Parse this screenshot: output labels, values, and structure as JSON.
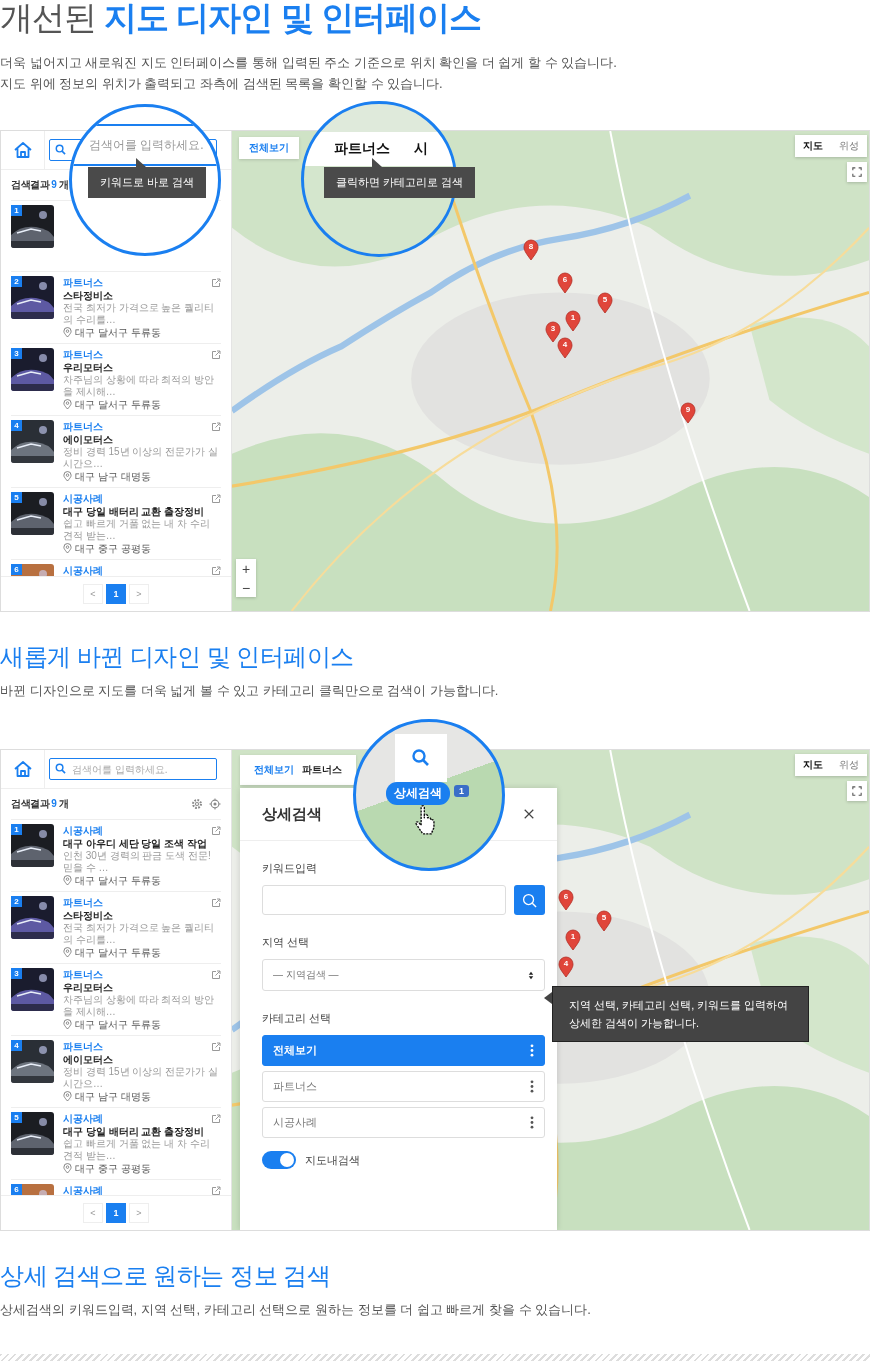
{
  "sections": [
    {
      "kind": "hero",
      "title": "개선된 **지도 디자인 및 인터페이스**",
      "description": [
        "더욱 넓어지고 새로워진 지도 인터페이스를 통해 입력된 주소 기준으로 위치 확인을 더 쉽게 할 수 있습니다.",
        "지도 위에 정보의 위치가 출력되고 좌측에 검색된 목록을 확인할 수 있습니다."
      ],
      "demo": {
        "sidebar": {
          "result_label": "검색결과",
          "result_count": "9",
          "result_unit": "개",
          "items": [
            {
              "kind": "covered",
              "number": "1"
            },
            {
              "kind": "full",
              "number": "2",
              "category": "파트너스",
              "title": "스타정비소",
              "description": "전국 최저가 가격으로 높은 퀄리티의 수리를…",
              "location": "대구 달서구 두류동"
            },
            {
              "kind": "full",
              "number": "3",
              "category": "파트너스",
              "title": "우리모터스",
              "description": "차주님의 상황에 따라 최적의 방안을 제시해…",
              "location": "대구 달서구 두류동"
            },
            {
              "kind": "full",
              "number": "4",
              "category": "파트너스",
              "title": "에이모터스",
              "description": "정비 경력 15년 이상의 전문가가 실시간으…",
              "location": "대구 남구 대명동"
            },
            {
              "kind": "full",
              "number": "5",
              "category": "시공사례",
              "title": "대구 당일 배터리 교환 출장정비",
              "description": "쉽고 빠르게 거품 없는 내 차 수리 견적 받는…",
              "location": "대구 중구 공평동"
            },
            {
              "kind": "partial",
              "number": "6",
              "category": "시공사례"
            }
          ],
          "pagination": {
            "prev": "<",
            "pages": [
              {
                "label": "1",
                "selected": true
              }
            ],
            "next": ">"
          }
        },
        "tabs": [
          {
            "label": "전체보기",
            "selected": true
          }
        ],
        "map": {
          "map_types": [
            {
              "label": "지도",
              "selected": true
            },
            {
              "label": "위성",
              "selected": false
            }
          ],
          "zoom": {
            "plus": "+",
            "minus": "−"
          },
          "markers": [
            {
              "label": "8"
            },
            {
              "label": "6"
            },
            {
              "label": "5"
            },
            {
              "label": "1"
            },
            {
              "label": "3"
            },
            {
              "label": "4"
            },
            {
              "label": "9"
            }
          ]
        },
        "magnifiers": [
          {
            "kind": "search",
            "placeholder": "검색어를 입력하세요.",
            "tooltip": "키워드로 바로 검색"
          },
          {
            "kind": "tabs",
            "tabs": [
              "파트너스",
              "시"
            ],
            "tooltip": "클릭하면 카테고리로 검색"
          }
        ]
      }
    },
    {
      "kind": "sub",
      "title": "새롭게 바뀐 디자인 및 인터페이스",
      "description": [
        "바뀐 디자인으로 지도를 더욱 넓게 볼 수 있고 카테고리 클릭만으로 검색이 가능합니다."
      ],
      "demo": {
        "sidebar": {
          "search_placeholder": "검색어를 입력하세요.",
          "result_label": "검색결과",
          "result_count": "9",
          "result_unit": "개",
          "tool_icons": true,
          "items": [
            {
              "kind": "full",
              "number": "1",
              "category": "시공사례",
              "title": "대구 아우디 세단 당일 조색 작업",
              "description": "인천 30년 경력의 판금 도색 전문! 믿을 수 …",
              "location": "대구 달서구 두류동"
            },
            {
              "kind": "full",
              "number": "2",
              "category": "파트너스",
              "title": "스타정비소",
              "description": "전국 최저가 가격으로 높은 퀄리티의 수리를…",
              "location": "대구 달서구 두류동"
            },
            {
              "kind": "full",
              "number": "3",
              "category": "파트너스",
              "title": "우리모터스",
              "description": "차주님의 상황에 따라 최적의 방안을 제시해…",
              "location": "대구 달서구 두류동"
            },
            {
              "kind": "full",
              "number": "4",
              "category": "파트너스",
              "title": "에이모터스",
              "description": "정비 경력 15년 이상의 전문가가 실시간으…",
              "location": "대구 남구 대명동"
            },
            {
              "kind": "full",
              "number": "5",
              "category": "시공사례",
              "title": "대구 당일 배터리 교환 출장정비",
              "description": "쉽고 빠르게 거품 없는 내 차 수리 견적 받는…",
              "location": "대구 중구 공평동"
            },
            {
              "kind": "partial",
              "number": "6",
              "category": "시공사례"
            }
          ],
          "pagination": {
            "prev": "<",
            "pages": [
              {
                "label": "1",
                "selected": true
              }
            ],
            "next": ">"
          }
        },
        "tabs": [
          {
            "label": "전체보기",
            "selected": true
          },
          {
            "label": "파트너스",
            "selected": false
          }
        ],
        "map": {
          "map_types": [
            {
              "label": "지도",
              "selected": true
            },
            {
              "label": "위성",
              "selected": false
            }
          ],
          "markers": [
            {
              "label": "6"
            },
            {
              "label": "5"
            },
            {
              "label": "1"
            },
            {
              "label": "4"
            }
          ]
        },
        "magnifiers": [
          {
            "kind": "button",
            "button": "상세검색",
            "badge": "1"
          }
        ],
        "panel": {
          "title": "상세검색",
          "keyword_label": "키워드입력",
          "region_label": "지역 선택",
          "region_select": "— 지역검색 —",
          "category_label": "카테고리 선택",
          "categories": [
            {
              "label": "전체보기",
              "selected": true
            },
            {
              "label": "파트너스",
              "selected": false
            },
            {
              "label": "시공사례",
              "selected": false
            }
          ],
          "map_search": {
            "label": "지도내검색",
            "on": true
          }
        },
        "tooltip": [
          "지역 선택, 카테고리 선택, 키워드를 입력하여",
          "상세한 검색이 가능합니다."
        ]
      }
    },
    {
      "kind": "sub",
      "title": "상세 검색으로 원하는 정보 검색",
      "description": [
        "상세검색의 키워드입력, 지역 선택, 카테고리 선택으로 원하는 정보를 더 쉽고 빠르게 찾을 수 있습니다."
      ]
    }
  ]
}
